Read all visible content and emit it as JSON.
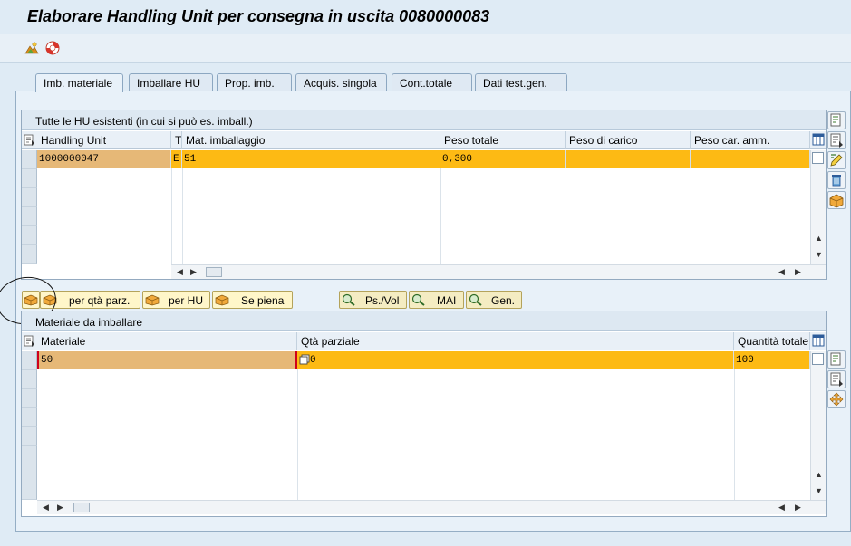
{
  "window": {
    "title": "Elaborare Handling Unit per consegna in uscita 0080000083"
  },
  "toolbar": {
    "icons": [
      "overview-icon",
      "help-ring-icon"
    ]
  },
  "tabs": [
    {
      "label": "Imb. materiale",
      "active": true
    },
    {
      "label": "Imballare HU",
      "active": false
    },
    {
      "label": "Prop. imb.",
      "active": false
    },
    {
      "label": "Acquis. singola",
      "active": false
    },
    {
      "label": "Cont.totale",
      "active": false
    },
    {
      "label": "Dati test.gen.",
      "active": false
    }
  ],
  "hu_table": {
    "title": "Tutte le HU esistenti (in cui si può es. imball.)",
    "columns": [
      "Handling Unit",
      "T",
      "Mat. imballaggio",
      "Peso totale",
      "Peso di carico",
      "Peso car. amm."
    ],
    "rows": [
      {
        "handling_unit": "1000000047",
        "t": "E",
        "mat": "51",
        "peso_totale": "0,300",
        "peso_carico": "",
        "peso_amm": ""
      }
    ]
  },
  "actions": {
    "pack_partial": "per qtà parz.",
    "pack_hu": "per HU",
    "if_full": "Se piena",
    "weight_vol": "Ps./Vol",
    "mai": "MAI",
    "gen": "Gen."
  },
  "material_table": {
    "title": "Materiale da imballare",
    "columns": [
      "Materiale",
      "Qtà parziale",
      "Quantità totale"
    ],
    "rows": [
      {
        "materiale": "50",
        "qta_parziale": "0",
        "qta_totale": "100"
      }
    ]
  },
  "colors": {
    "highlight_row": "#fdba14",
    "key_cell": "#e6b877",
    "panel_bg": "#e8f1f9"
  }
}
